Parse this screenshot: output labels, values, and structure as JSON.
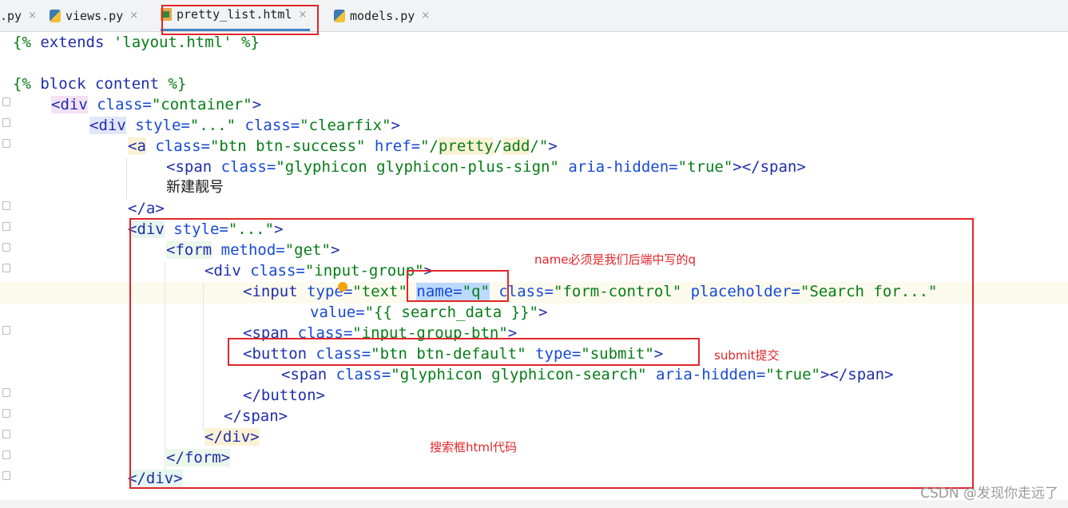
{
  "tabs": [
    {
      "label": ".py",
      "icon": "python-file-icon",
      "active": false
    },
    {
      "label": "views.py",
      "icon": "python-file-icon",
      "active": false
    },
    {
      "label": "pretty_list.html",
      "icon": "html-file-icon",
      "active": true
    },
    {
      "label": "models.py",
      "icon": "python-file-icon",
      "active": false
    }
  ],
  "close_glyph": "×",
  "code": {
    "l1": {
      "a": "{% ",
      "b": "extends",
      "c": " 'layout.html' ",
      "d": "%}"
    },
    "l3": {
      "a": "{% ",
      "b": "block",
      "c": " ",
      "d": "content",
      "e": " %}"
    },
    "l4": {
      "open": "<",
      "tag": "div",
      "attr": " class=",
      "val": "\"container\"",
      "close": ">"
    },
    "l5": {
      "open": "<",
      "tag": "div",
      "attr1": " style=",
      "val1": "\"...\"",
      "attr2": " class=",
      "val2": "\"clearfix\"",
      "close": ">"
    },
    "l6": {
      "open": "<",
      "tag": "a",
      "attr1": " class=",
      "val1": "\"btn btn-success\"",
      "attr2": " href=",
      "val2a": "\"/",
      "val2b": "pretty",
      "val2c": "/",
      "val2d": "add",
      "val2e": "/\"",
      "close": ">"
    },
    "l7": {
      "open": "<",
      "tag": "span",
      "attr1": " class=",
      "val1": "\"glyphicon glyphicon-plus-sign\"",
      "attr2": " aria-hidden=",
      "val2": "\"true\"",
      "mid": "></",
      "tag2": "span",
      "close": ">"
    },
    "l8": {
      "text": "新建靓号"
    },
    "l9": {
      "open": "</",
      "tag": "a",
      "close": ">"
    },
    "l10": {
      "open": "<",
      "tag": "div",
      "attr": " style=",
      "val": "\"...\"",
      "close": ">"
    },
    "l11": {
      "open": "<",
      "tag": "form",
      "attr": " method=",
      "val": "\"get\"",
      "close": ">"
    },
    "l12": {
      "open": "<",
      "tag": "div",
      "attr": " class=",
      "val": "\"input-group\"",
      "close": ">"
    },
    "l13": {
      "open": "<",
      "tag": "input",
      "attr1": " type=",
      "val1": "\"text\"",
      "sp": " ",
      "attr2": "name=",
      "val2": "\"q\"",
      "attr3": " class=",
      "val3": "\"form-control\"",
      "attr4": " placeholder=",
      "val4": "\"Search for...\""
    },
    "l14": {
      "attr": "value=",
      "val": "\"{{ search_data }}\"",
      "close": ">"
    },
    "l15": {
      "open": "<",
      "tag": "span",
      "attr": " class=",
      "val": "\"input-group-btn\"",
      "close": ">"
    },
    "l16": {
      "open": "<",
      "tag": "button",
      "attr1": " class=",
      "val1": "\"btn btn-default\"",
      "attr2": " type=",
      "val2": "\"submit\"",
      "close": ">"
    },
    "l17": {
      "open": "<",
      "tag": "span",
      "attr1": " class=",
      "val1": "\"glyphicon glyphicon-search\"",
      "attr2": " aria-hidden=",
      "val2": "\"true\"",
      "mid": "></",
      "tag2": "span",
      "close": ">"
    },
    "l18": {
      "open": "</",
      "tag": "button",
      "close": ">"
    },
    "l19": {
      "open": "</",
      "tag": "span",
      "close": ">"
    },
    "l20": {
      "open": "</",
      "tag": "div",
      "close": ">"
    },
    "l21": {
      "open": "</",
      "tag": "form",
      "close": ">"
    },
    "l22": {
      "open": "</",
      "tag": "div",
      "close": ">"
    }
  },
  "annotations": {
    "name_note": "name必须是我们后端中写的q",
    "submit_note": "submit提交",
    "search_note": "搜索框html代码"
  },
  "watermark": "CSDN @发现你走远了",
  "colors": {
    "annotation": "#e0262a",
    "tag": "#1f2eaa",
    "string": "#067d17",
    "attribute": "#174ad4"
  }
}
